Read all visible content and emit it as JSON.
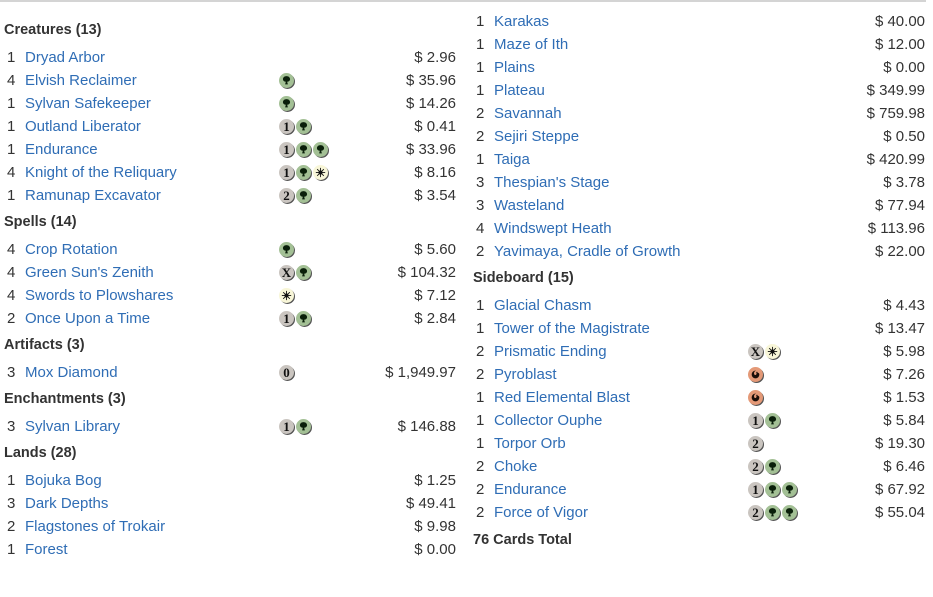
{
  "colors": {
    "link": "#2f6db5",
    "text": "#333333",
    "green_mana": "#a3c095",
    "white_mana": "#f8f6d8",
    "red_mana": "#e49977",
    "generic_mana": "#cac5c0"
  },
  "left_column": [
    {
      "title": "Creatures (13)",
      "cards": [
        {
          "qty": "1",
          "name": "Dryad Arbor",
          "cost": [],
          "price": "$ 2.96"
        },
        {
          "qty": "4",
          "name": "Elvish Reclaimer",
          "cost": [
            "green-mana"
          ],
          "price": "$ 35.96"
        },
        {
          "qty": "1",
          "name": "Sylvan Safekeeper",
          "cost": [
            "green-mana"
          ],
          "price": "$ 14.26"
        },
        {
          "qty": "1",
          "name": "Outland Liberator",
          "cost": [
            "1",
            "green-mana"
          ],
          "price": "$ 0.41"
        },
        {
          "qty": "1",
          "name": "Endurance",
          "cost": [
            "1",
            "green-mana",
            "green-mana"
          ],
          "price": "$ 33.96"
        },
        {
          "qty": "4",
          "name": "Knight of the Reliquary",
          "cost": [
            "1",
            "green-mana",
            "white-mana"
          ],
          "price": "$ 8.16"
        },
        {
          "qty": "1",
          "name": "Ramunap Excavator",
          "cost": [
            "2",
            "green-mana"
          ],
          "price": "$ 3.54"
        }
      ]
    },
    {
      "title": "Spells (14)",
      "cards": [
        {
          "qty": "4",
          "name": "Crop Rotation",
          "cost": [
            "green-mana"
          ],
          "price": "$ 5.60"
        },
        {
          "qty": "4",
          "name": "Green Sun's Zenith",
          "cost": [
            "X",
            "green-mana"
          ],
          "price": "$ 104.32"
        },
        {
          "qty": "4",
          "name": "Swords to Plowshares",
          "cost": [
            "white-mana"
          ],
          "price": "$ 7.12"
        },
        {
          "qty": "2",
          "name": "Once Upon a Time",
          "cost": [
            "1",
            "green-mana"
          ],
          "price": "$ 2.84"
        }
      ]
    },
    {
      "title": "Artifacts (3)",
      "cards": [
        {
          "qty": "3",
          "name": "Mox Diamond",
          "cost": [
            "0"
          ],
          "price": "$ 1,949.97"
        }
      ]
    },
    {
      "title": "Enchantments (3)",
      "cards": [
        {
          "qty": "3",
          "name": "Sylvan Library",
          "cost": [
            "1",
            "green-mana"
          ],
          "price": "$ 146.88"
        }
      ]
    },
    {
      "title": "Lands (28)",
      "cards": [
        {
          "qty": "1",
          "name": "Bojuka Bog",
          "cost": [],
          "price": "$ 1.25"
        },
        {
          "qty": "3",
          "name": "Dark Depths",
          "cost": [],
          "price": "$ 49.41"
        },
        {
          "qty": "2",
          "name": "Flagstones of Trokair",
          "cost": [],
          "price": "$ 9.98"
        },
        {
          "qty": "1",
          "name": "Forest",
          "cost": [],
          "price": "$ 0.00"
        }
      ]
    }
  ],
  "right_column": [
    {
      "title": "",
      "cards": [
        {
          "qty": "1",
          "name": "Karakas",
          "cost": [],
          "price": "$ 40.00"
        },
        {
          "qty": "1",
          "name": "Maze of Ith",
          "cost": [],
          "price": "$ 12.00"
        },
        {
          "qty": "1",
          "name": "Plains",
          "cost": [],
          "price": "$ 0.00"
        },
        {
          "qty": "1",
          "name": "Plateau",
          "cost": [],
          "price": "$ 349.99"
        },
        {
          "qty": "2",
          "name": "Savannah",
          "cost": [],
          "price": "$ 759.98"
        },
        {
          "qty": "2",
          "name": "Sejiri Steppe",
          "cost": [],
          "price": "$ 0.50"
        },
        {
          "qty": "1",
          "name": "Taiga",
          "cost": [],
          "price": "$ 420.99"
        },
        {
          "qty": "3",
          "name": "Thespian's Stage",
          "cost": [],
          "price": "$ 3.78"
        },
        {
          "qty": "3",
          "name": "Wasteland",
          "cost": [],
          "price": "$ 77.94"
        },
        {
          "qty": "4",
          "name": "Windswept Heath",
          "cost": [],
          "price": "$ 113.96"
        },
        {
          "qty": "2",
          "name": "Yavimaya, Cradle of Growth",
          "cost": [],
          "price": "$ 22.00"
        }
      ]
    },
    {
      "title": "Sideboard (15)",
      "cards": [
        {
          "qty": "1",
          "name": "Glacial Chasm",
          "cost": [],
          "price": "$ 4.43"
        },
        {
          "qty": "1",
          "name": "Tower of the Magistrate",
          "cost": [],
          "price": "$ 13.47"
        },
        {
          "qty": "2",
          "name": "Prismatic Ending",
          "cost": [
            "X",
            "white-mana"
          ],
          "price": "$ 5.98"
        },
        {
          "qty": "2",
          "name": "Pyroblast",
          "cost": [
            "red-mana"
          ],
          "price": "$ 7.26"
        },
        {
          "qty": "1",
          "name": "Red Elemental Blast",
          "cost": [
            "red-mana"
          ],
          "price": "$ 1.53"
        },
        {
          "qty": "1",
          "name": "Collector Ouphe",
          "cost": [
            "1",
            "green-mana"
          ],
          "price": "$ 5.84"
        },
        {
          "qty": "1",
          "name": "Torpor Orb",
          "cost": [
            "2"
          ],
          "price": "$ 19.30"
        },
        {
          "qty": "2",
          "name": "Choke",
          "cost": [
            "2",
            "green-mana"
          ],
          "price": "$ 6.46"
        },
        {
          "qty": "2",
          "name": "Endurance",
          "cost": [
            "1",
            "green-mana",
            "green-mana"
          ],
          "price": "$ 67.92"
        },
        {
          "qty": "2",
          "name": "Force of Vigor",
          "cost": [
            "2",
            "green-mana",
            "green-mana"
          ],
          "price": "$ 55.04"
        }
      ]
    }
  ],
  "total": "76 Cards Total"
}
